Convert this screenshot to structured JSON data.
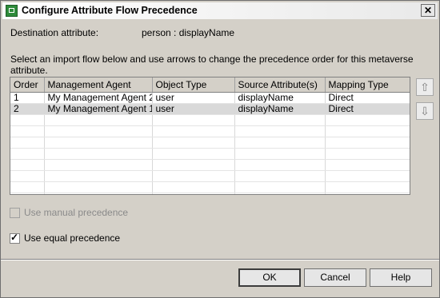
{
  "window": {
    "title": "Configure Attribute Flow Precedence",
    "close_label": "✕"
  },
  "destination": {
    "label": "Destination attribute:",
    "value": "person : displayName"
  },
  "instruction": {
    "line1": "Select an import flow below and use arrows to change the precedence order for this metaverse",
    "line2": "attribute."
  },
  "table": {
    "columns": [
      "Order",
      "Management Agent",
      "Object Type",
      "Source Attribute(s)",
      "Mapping Type"
    ],
    "rows": [
      [
        "1",
        "My Management Agent 2",
        "user",
        "displayName",
        "Direct"
      ],
      [
        "2",
        "My Management Agent 1",
        "user",
        "displayName",
        "Direct"
      ]
    ],
    "selected_row": 2
  },
  "arrows": {
    "up_icon": "arrow-up-icon",
    "down_icon": "arrow-down-icon",
    "up": "⇧",
    "down": "⇩"
  },
  "options": {
    "manual": {
      "label": "Use manual precedence",
      "checked": false,
      "enabled": false
    },
    "equal": {
      "label": "Use equal precedence",
      "checked": true,
      "enabled": true
    }
  },
  "buttons": {
    "ok": "OK",
    "cancel": "Cancel",
    "help": "Help"
  }
}
